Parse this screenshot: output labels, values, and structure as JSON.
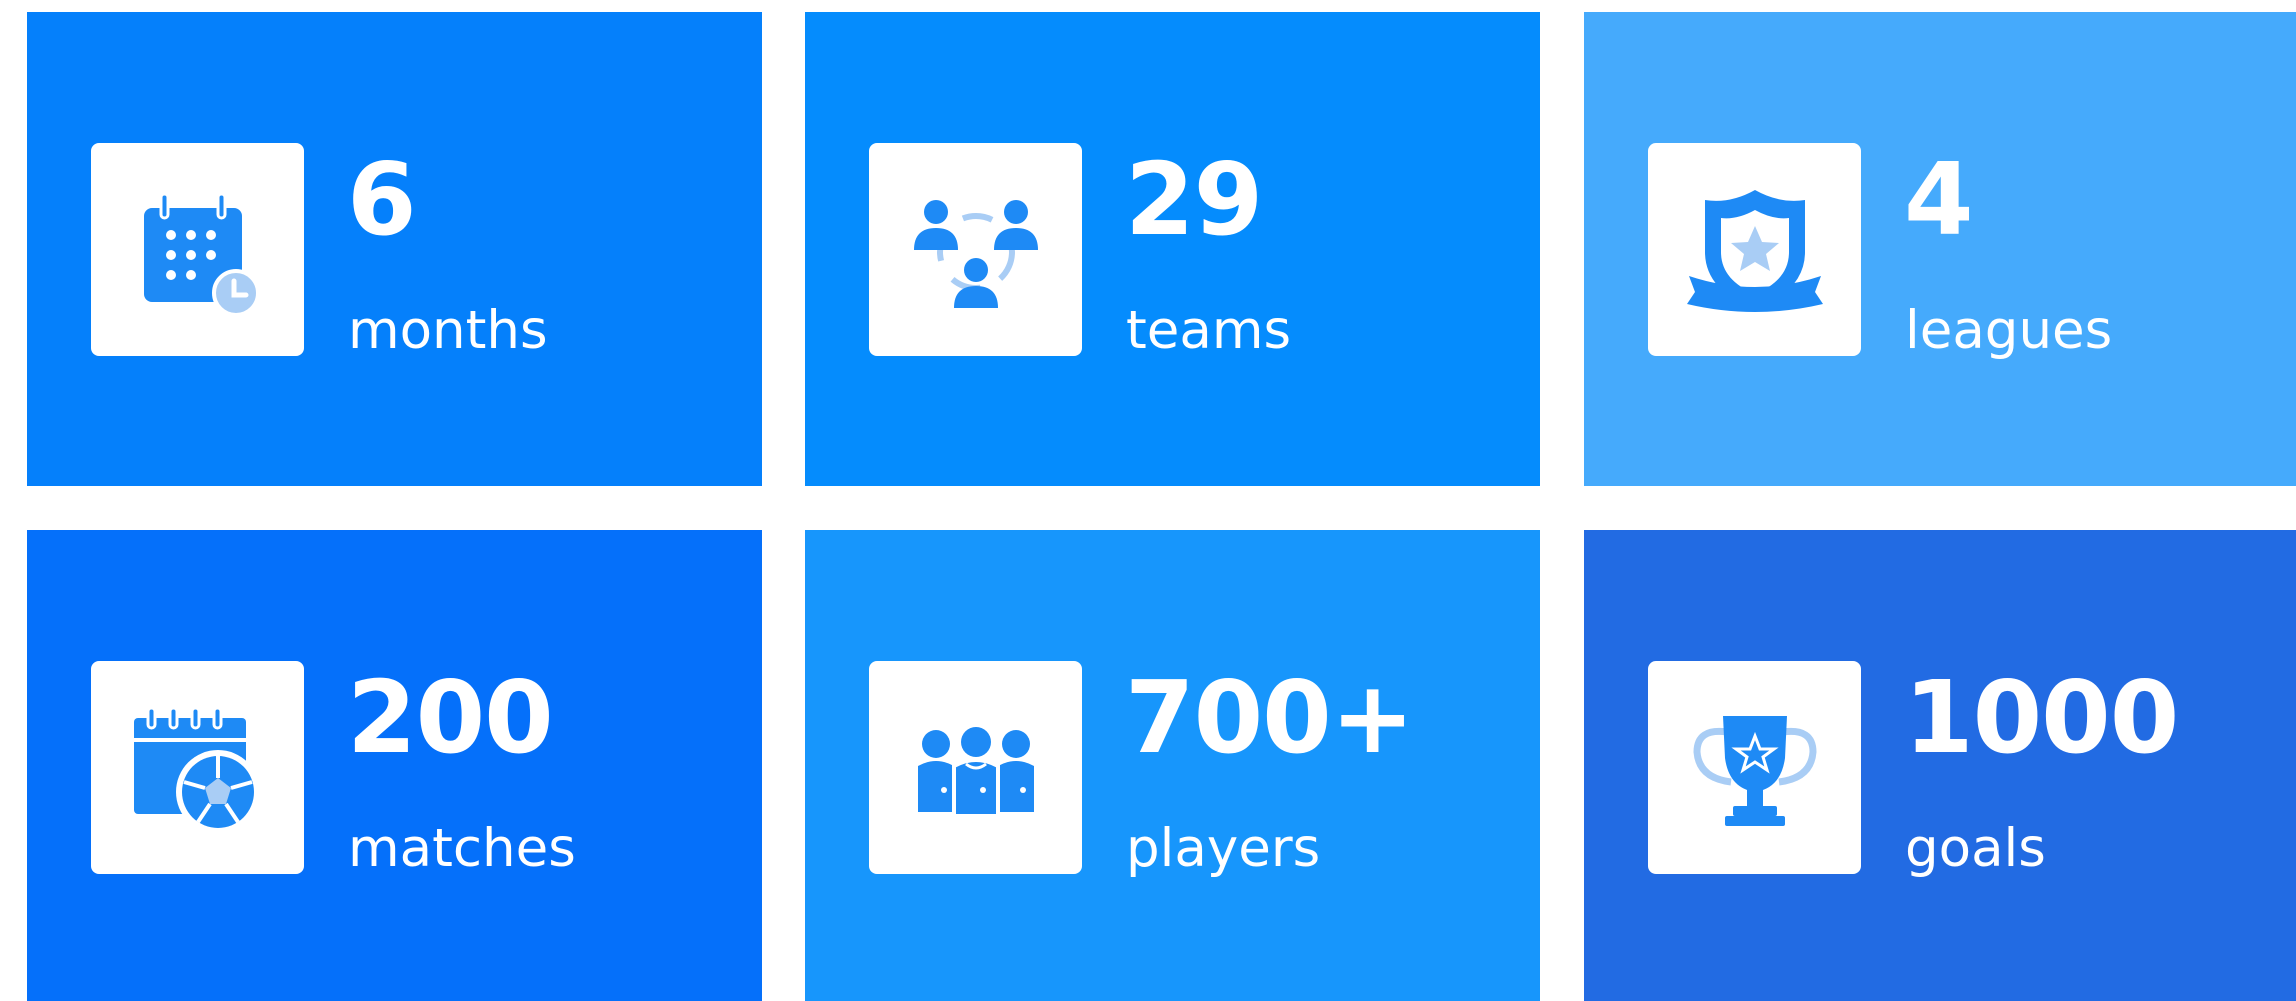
{
  "colors": {
    "primary_icon": "#1e8af5",
    "secondary_icon": "#a9cdf5"
  },
  "stats": [
    {
      "value": "6",
      "label": "months",
      "icon": "calendar-clock-icon",
      "bg": "#0580fb"
    },
    {
      "value": "29",
      "label": "teams",
      "icon": "team-network-icon",
      "bg": "#058cfd"
    },
    {
      "value": "4",
      "label": "leagues",
      "icon": "shield-star-icon",
      "bg": "#45aafc"
    },
    {
      "value": "200",
      "label": "matches",
      "icon": "calendar-ball-icon",
      "bg": "#0570fa"
    },
    {
      "value": "700+",
      "label": "players",
      "icon": "players-group-icon",
      "bg": "#1796fc"
    },
    {
      "value": "1000",
      "label": "goals",
      "icon": "trophy-icon",
      "bg": "#226be3"
    }
  ]
}
